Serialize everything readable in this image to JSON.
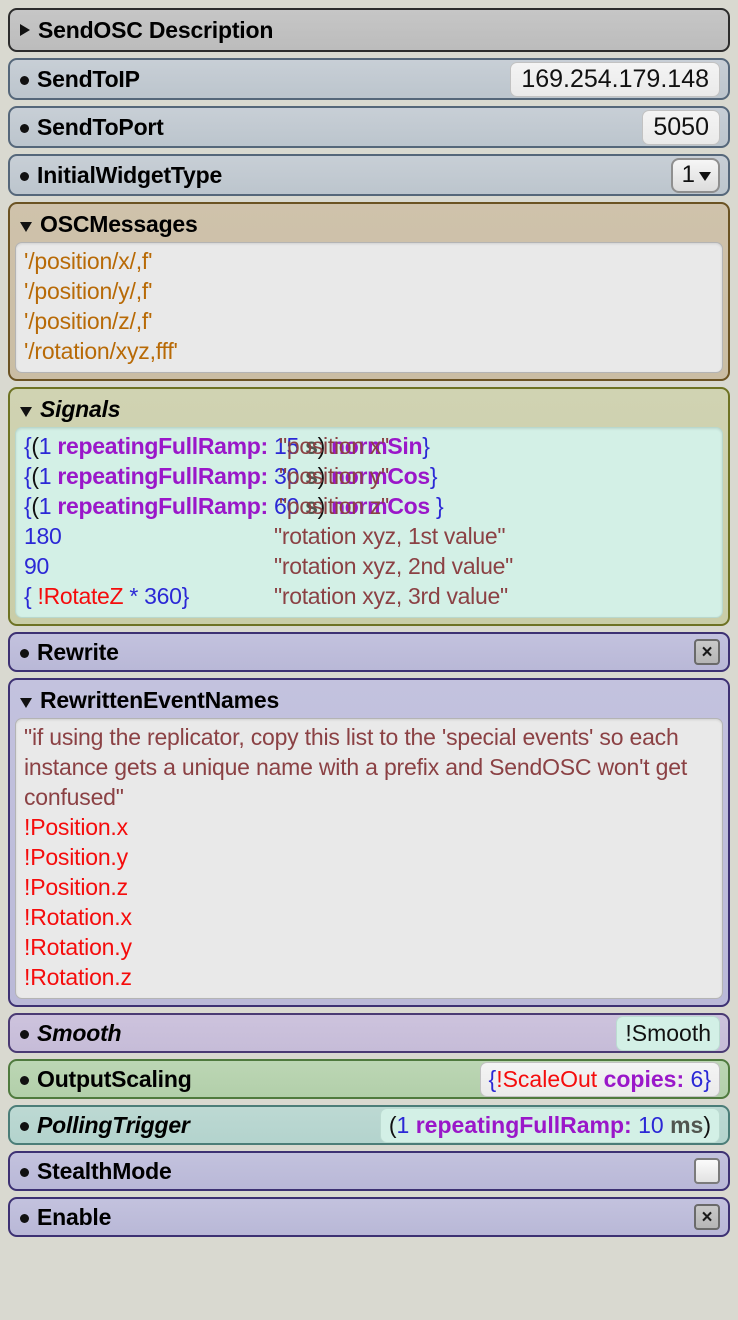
{
  "header": {
    "bullet": "triangle-right-icon",
    "title": "SendOSC Description"
  },
  "rows": {
    "send_to_ip": {
      "label": "SendToIP",
      "value": "169.254.179.148"
    },
    "send_to_port": {
      "label": "SendToPort",
      "value": "5050"
    },
    "initial_widget_type": {
      "label": "InitialWidgetType",
      "value": "1"
    }
  },
  "osc_messages": {
    "title": "OSCMessages",
    "lines": [
      "'/position/x/,f'",
      "'/position/y/,f'",
      "'/position/z/,f'",
      "'/rotation/xyz,fff'"
    ]
  },
  "signals": {
    "title": "Signals",
    "lines": [
      {
        "tokens": [
          {
            "t": "{",
            "c": "curly"
          },
          {
            "t": "(",
            "c": "black"
          },
          {
            "t": "1",
            "c": "blue"
          },
          {
            "t": " ",
            "c": "black"
          },
          {
            "t": "repeatingFullRamp:",
            "c": "purple"
          },
          {
            "t": " ",
            "c": "black"
          },
          {
            "t": "15",
            "c": "blue"
          },
          {
            "t": " ",
            "c": "black"
          },
          {
            "t": "s",
            "c": "gray"
          },
          {
            "t": ")",
            "c": "black"
          },
          {
            "t": " ",
            "c": "black"
          },
          {
            "t": "normSin",
            "c": "purple"
          },
          {
            "t": "}",
            "c": "curly"
          }
        ],
        "comment": "\"position x\""
      },
      {
        "tokens": [
          {
            "t": "{",
            "c": "curly"
          },
          {
            "t": "(",
            "c": "black"
          },
          {
            "t": "1",
            "c": "blue"
          },
          {
            "t": " ",
            "c": "black"
          },
          {
            "t": "repeatingFullRamp:",
            "c": "purple"
          },
          {
            "t": " ",
            "c": "black"
          },
          {
            "t": "30",
            "c": "blue"
          },
          {
            "t": " ",
            "c": "black"
          },
          {
            "t": "s",
            "c": "gray"
          },
          {
            "t": ")",
            "c": "black"
          },
          {
            "t": " ",
            "c": "black"
          },
          {
            "t": "normCos",
            "c": "purple"
          },
          {
            "t": "}",
            "c": "curly"
          }
        ],
        "comment": "\"position y\""
      },
      {
        "tokens": [
          {
            "t": "{",
            "c": "curly"
          },
          {
            "t": "(",
            "c": "black"
          },
          {
            "t": "1",
            "c": "blue"
          },
          {
            "t": " ",
            "c": "black"
          },
          {
            "t": "repeatingFullRamp:",
            "c": "purple"
          },
          {
            "t": " ",
            "c": "black"
          },
          {
            "t": "60",
            "c": "blue"
          },
          {
            "t": " ",
            "c": "black"
          },
          {
            "t": "s",
            "c": "gray"
          },
          {
            "t": ")",
            "c": "black"
          },
          {
            "t": " ",
            "c": "black"
          },
          {
            "t": "normCos",
            "c": "purple"
          },
          {
            "t": " ",
            "c": "black"
          },
          {
            "t": "}",
            "c": "curly"
          }
        ],
        "comment": "\"position z\""
      },
      {
        "tokens": [
          {
            "t": "180",
            "c": "blue"
          }
        ],
        "comment": "\"rotation xyz, 1st value\""
      },
      {
        "tokens": [
          {
            "t": "90",
            "c": "blue"
          }
        ],
        "comment": "\"rotation xyz, 2nd value\""
      },
      {
        "tokens": [
          {
            "t": "{ ",
            "c": "curly"
          },
          {
            "t": "!RotateZ",
            "c": "red"
          },
          {
            "t": " * ",
            "c": "blue"
          },
          {
            "t": "360}",
            "c": "blue"
          }
        ],
        "comment": "\"rotation xyz, 3rd value\""
      }
    ]
  },
  "rewrite": {
    "label": "Rewrite",
    "checked": true,
    "check_glyph": "×"
  },
  "rewritten_event_names": {
    "title": "RewrittenEventNames",
    "comment": "\"if using the replicator, copy this list to the 'special events' so each instance gets a unique name with a prefix and SendOSC won't get confused\"",
    "events": [
      "!Position.x",
      "!Position.y",
      "!Position.z",
      "!Rotation.x",
      "!Rotation.y",
      "!Rotation.z"
    ]
  },
  "smooth": {
    "label": "Smooth",
    "value": "!Smooth"
  },
  "output_scaling": {
    "label": "OutputScaling",
    "tokens": [
      {
        "t": "{",
        "c": "curly"
      },
      {
        "t": "!ScaleOut",
        "c": "red"
      },
      {
        "t": " ",
        "c": "black"
      },
      {
        "t": "copies:",
        "c": "purple"
      },
      {
        "t": " ",
        "c": "black"
      },
      {
        "t": "6",
        "c": "blue"
      },
      {
        "t": "}",
        "c": "curly"
      }
    ]
  },
  "polling_trigger": {
    "label": "PollingTrigger",
    "tokens": [
      {
        "t": "(",
        "c": "black"
      },
      {
        "t": "1",
        "c": "blue"
      },
      {
        "t": " ",
        "c": "black"
      },
      {
        "t": "repeatingFullRamp:",
        "c": "purple"
      },
      {
        "t": " ",
        "c": "black"
      },
      {
        "t": "10",
        "c": "blue"
      },
      {
        "t": " ",
        "c": "black"
      },
      {
        "t": "ms",
        "c": "gray"
      },
      {
        "t": ")",
        "c": "black"
      }
    ]
  },
  "stealth_mode": {
    "label": "StealthMode",
    "checked": false
  },
  "enable": {
    "label": "Enable",
    "checked": true,
    "check_glyph": "×"
  },
  "colors": {
    "background": "#d9d9d0",
    "osc_text": "#b86a06",
    "comment": "#8b4144",
    "event_red": "#f50c0c",
    "number_blue": "#2b28d6",
    "keyword_purple": "#9a17c9",
    "unit_gray": "#51564f"
  }
}
